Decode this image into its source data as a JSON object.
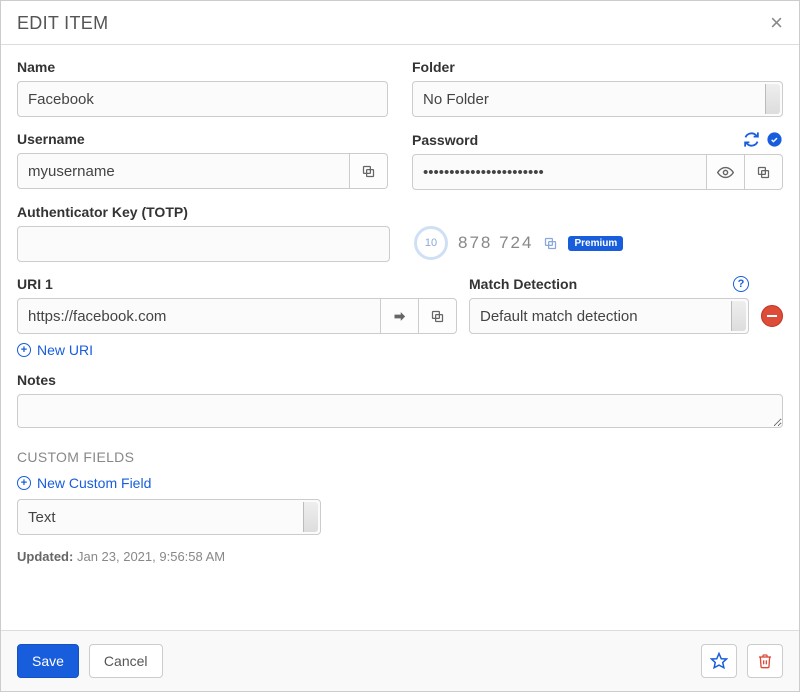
{
  "header": {
    "title": "EDIT ITEM"
  },
  "fields": {
    "name_label": "Name",
    "name_value": "Facebook",
    "folder_label": "Folder",
    "folder_value": "No Folder",
    "username_label": "Username",
    "username_value": "myusername",
    "password_label": "Password",
    "password_value": "•••••••••••••••••••••••",
    "totp_label": "Authenticator Key (TOTP)",
    "totp_value": "",
    "totp_countdown": "10",
    "totp_code": "878  724",
    "premium_badge": "Premium",
    "uri1_label": "URI 1",
    "uri1_value": "https://facebook.com",
    "match_label": "Match Detection",
    "match_value": "Default match detection",
    "new_uri": "New URI",
    "notes_label": "Notes",
    "notes_value": ""
  },
  "custom_fields": {
    "heading": "CUSTOM FIELDS",
    "new_field": "New Custom Field",
    "type_value": "Text"
  },
  "meta": {
    "updated_label": "Updated:",
    "updated_value": "Jan 23, 2021, 9:56:58 AM"
  },
  "footer": {
    "save": "Save",
    "cancel": "Cancel"
  }
}
